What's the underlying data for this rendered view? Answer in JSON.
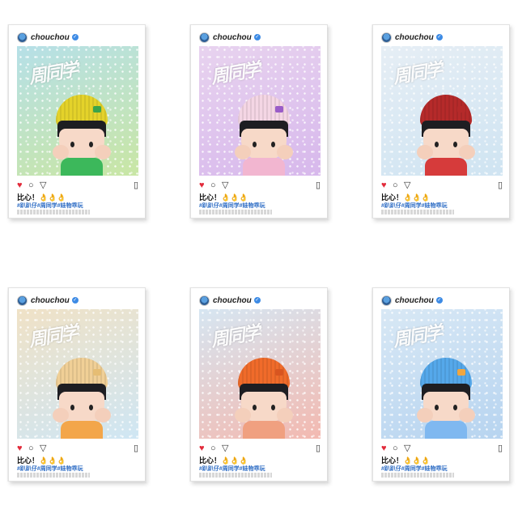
{
  "cards": [
    {
      "username": "chouchou",
      "caption": "比心！👌👌👌",
      "tags": "#趴趴仔#周同学#娃物乖玩",
      "bg": "#c9e6a4",
      "bg2": "#b6e0e8",
      "hat": "#e4d22a",
      "shirt": "#3cb85b",
      "patch": "#3aa44b"
    },
    {
      "username": "chouchou",
      "caption": "比心！👌👌👌",
      "tags": "#趴趴仔#周同学#娃物乖玩",
      "bg": "#d7b8ec",
      "bg2": "#e8d3ef",
      "hat": "#f4d6e4",
      "shirt": "#f2b6d0",
      "patch": "#9a5cc8"
    },
    {
      "username": "chouchou",
      "caption": "比心！👌👌👌",
      "tags": "#趴趴仔#周同学#娃物乖玩",
      "bg": "#cfe4f2",
      "bg2": "#e6eef5",
      "hat": "#b52a2a",
      "shirt": "#d63b3b",
      "patch": "#b52a2a"
    },
    {
      "username": "chouchou",
      "caption": "比心！👌👌👌",
      "tags": "#趴趴仔#周同学#娃物乖玩",
      "bg": "#cfe6f4",
      "bg2": "#f0e2c6",
      "hat": "#f0cf96",
      "shirt": "#f3a64a",
      "patch": "#e6bd73"
    },
    {
      "username": "chouchou",
      "caption": "比心！👌👌👌",
      "tags": "#趴趴仔#周同学#娃物乖玩",
      "bg": "#f3b9b0",
      "bg2": "#d6e6f2",
      "hat": "#f06b2a",
      "shirt": "#f0a080",
      "patch": "#d85520"
    },
    {
      "username": "chouchou",
      "caption": "比心！👌👌👌",
      "tags": "#趴趴仔#周同学#娃物乖玩",
      "bg": "#b7d4f0",
      "bg2": "#d8e8f5",
      "hat": "#55a8ea",
      "shirt": "#7fb8f0",
      "patch": "#f0a640"
    }
  ],
  "brand_text": "周同学",
  "icons": {
    "like": "heart-icon",
    "comment": "comment-icon",
    "share": "send-icon",
    "save": "bookmark-icon"
  }
}
